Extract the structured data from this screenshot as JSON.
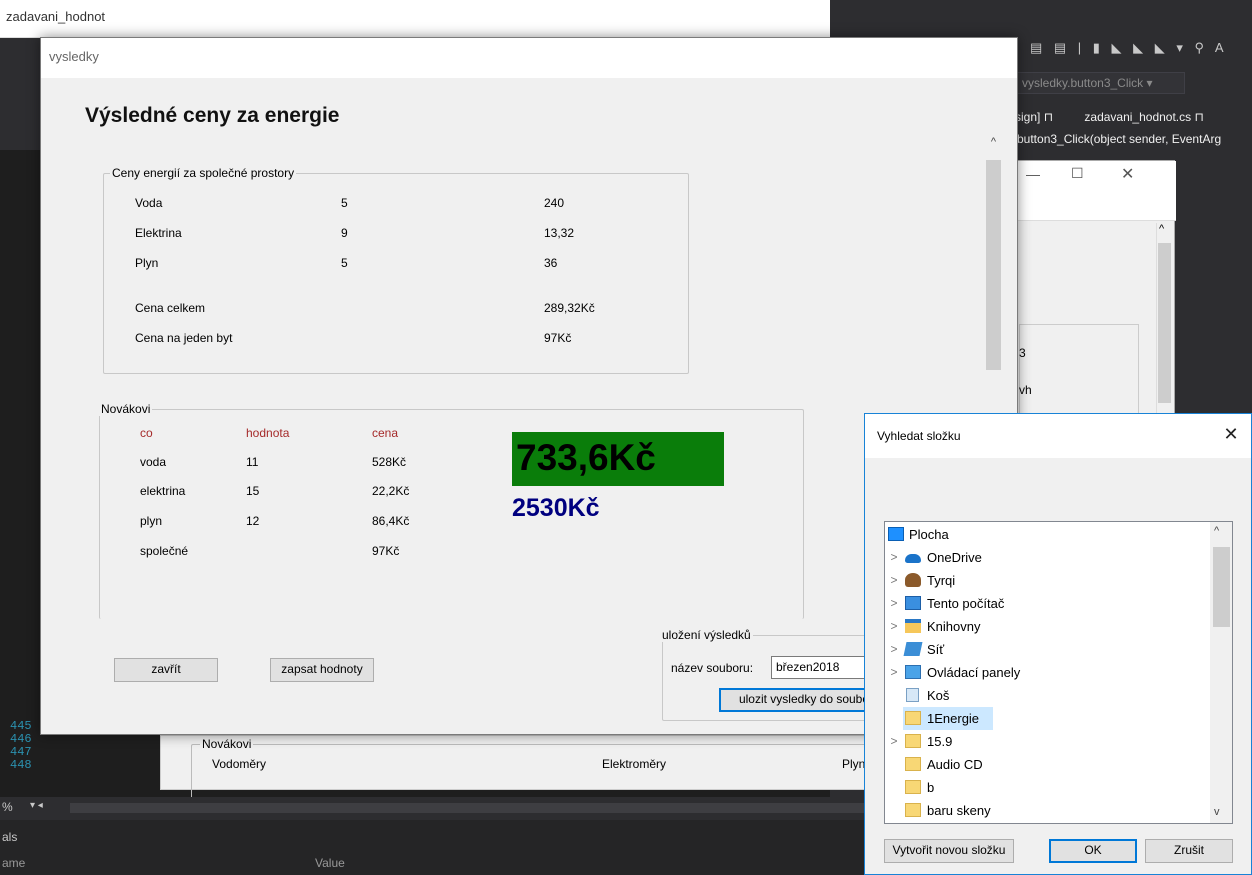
{
  "vs": {
    "nav_method": "vysledky.button3_Click",
    "tab_design": "sign]",
    "tab_file": "zadavani_hodnot.cs",
    "code_sig": "button3_Click(object sender, EventArg",
    "line_numbers": [
      "445",
      "446",
      "447",
      "448"
    ],
    "zoom": "%",
    "locals_title": "als",
    "col_name": "ame",
    "col_value": "Value"
  },
  "zadavani": {
    "title": "zadavani_hodnot",
    "group": "Novákovi",
    "col_vodomery": "Vodoměry",
    "col_elektromery": "Elektroměry",
    "col_plyn": "Plyn"
  },
  "bg_form": {
    "text_b": "3",
    "text_vh": "vh"
  },
  "vysledky": {
    "title": "vysledky",
    "heading": "Výsledné ceny za energie",
    "common": {
      "legend": "Ceny energií za společné prostory",
      "rows": [
        {
          "name": "Voda",
          "value": "5",
          "price": "240"
        },
        {
          "name": "Elektrina",
          "value": "9",
          "price": "13,32"
        },
        {
          "name": "Plyn",
          "value": "5",
          "price": "36"
        }
      ],
      "total_label": "Cena celkem",
      "total_value": "289,32Kč",
      "per_flat_label": "Cena na jeden byt",
      "per_flat_value": "97Kč"
    },
    "novakovi": {
      "legend": "Novákovi",
      "headers": {
        "co": "co",
        "hodnota": "hodnota",
        "cena": "cena"
      },
      "rows": [
        {
          "co": "voda",
          "hodnota": "11",
          "cena": "528Kč"
        },
        {
          "co": "elektrina",
          "hodnota": "15",
          "cena": "22,2Kč"
        },
        {
          "co": "plyn",
          "hodnota": "12",
          "cena": "86,4Kč"
        },
        {
          "co": "společné",
          "hodnota": "",
          "cena": "97Kč"
        }
      ],
      "total_green": "733,6Kč",
      "total_blue": "2530Kč"
    },
    "save": {
      "legend": "uložení výsledků",
      "filename_label": "název souboru:",
      "filename_value": "březen2018",
      "save_button": "ulozit vysledky do soubo"
    },
    "close_button": "zavřít",
    "write_button": "zapsat hodnoty"
  },
  "dialog": {
    "title": "Vyhledat složku",
    "items": [
      {
        "label": "Plocha",
        "icon": "desktop-icon",
        "expand": ""
      },
      {
        "label": "OneDrive",
        "icon": "cloud-icon",
        "expand": ">"
      },
      {
        "label": "Tyrqi",
        "icon": "user-icon",
        "expand": ">"
      },
      {
        "label": "Tento počítač",
        "icon": "computer-icon",
        "expand": ">"
      },
      {
        "label": "Knihovny",
        "icon": "library-icon",
        "expand": ">"
      },
      {
        "label": "Síť",
        "icon": "network-icon",
        "expand": ">"
      },
      {
        "label": "Ovládací panely",
        "icon": "control-panel-icon",
        "expand": ">"
      },
      {
        "label": "Koš",
        "icon": "recycle-bin-icon",
        "expand": ""
      },
      {
        "label": "1Energie",
        "icon": "folder-icon",
        "expand": ""
      },
      {
        "label": "15.9",
        "icon": "folder-icon",
        "expand": ">"
      },
      {
        "label": "Audio CD",
        "icon": "folder-icon",
        "expand": ""
      },
      {
        "label": "b",
        "icon": "folder-icon",
        "expand": ""
      },
      {
        "label": "baru skeny",
        "icon": "folder-icon",
        "expand": ""
      }
    ],
    "selected": "1Energie",
    "new_folder_button": "Vytvořit novou složku",
    "ok_button": "OK",
    "cancel_button": "Zrušit"
  }
}
